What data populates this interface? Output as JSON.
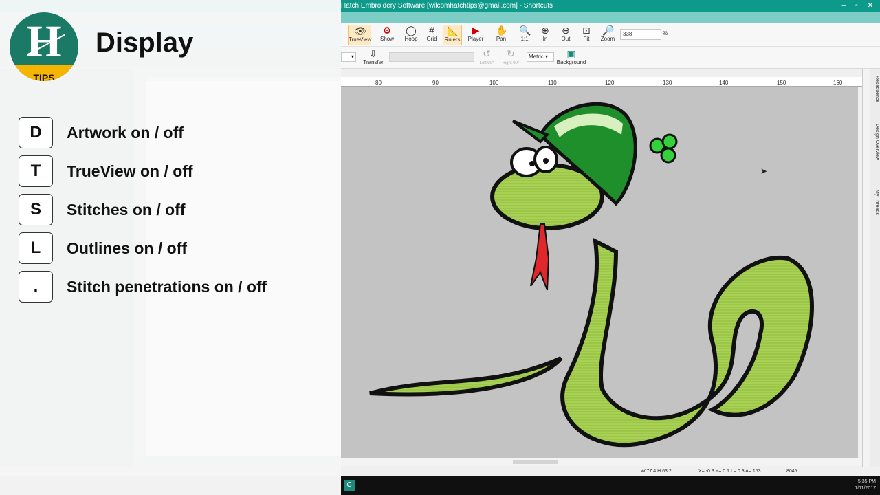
{
  "overlay": {
    "logo_letter": "H",
    "logo_tips": "TIPS",
    "heading": "Display",
    "shortcuts": [
      {
        "key": "D",
        "label": "Artwork on / off"
      },
      {
        "key": "T",
        "label": "TrueView on / off"
      },
      {
        "key": "S",
        "label": "Stitches on / off"
      },
      {
        "key": "L",
        "label": "Outlines on / off"
      },
      {
        "key": ".",
        "label": "Stitch penetrations on / off"
      }
    ]
  },
  "app": {
    "title": "Hatch Embroidery Software [wilcomhatchtips@gmail.com] - Shortcuts",
    "window_buttons": [
      "–",
      "▫",
      "✕"
    ],
    "toolbar1": [
      {
        "label": "TrueView",
        "icon": "trueview-icon"
      },
      {
        "label": "Show",
        "icon": "show-icon"
      },
      {
        "label": "Hoop",
        "icon": "hoop-icon"
      },
      {
        "label": "Grid",
        "icon": "grid-icon"
      },
      {
        "label": "Rulers",
        "icon": "rulers-icon"
      },
      {
        "label": "Player",
        "icon": "player-icon"
      },
      {
        "label": "Pan",
        "icon": "pan-icon"
      },
      {
        "label": "1:1",
        "icon": "zoom-1-1-icon"
      },
      {
        "label": "In",
        "icon": "zoom-in-icon"
      },
      {
        "label": "Out",
        "icon": "zoom-out-icon"
      },
      {
        "label": "Fit",
        "icon": "zoom-fit-icon"
      },
      {
        "label": "Zoom",
        "icon": "zoom-icon"
      }
    ],
    "zoom_value": "338",
    "zoom_unit": "%",
    "toolbar2": {
      "transfer": "Transfer",
      "left": "Left 90°",
      "right": "Right 90°",
      "metric": "Metric",
      "background": "Background"
    },
    "ruler_ticks": [
      "80",
      "90",
      "100",
      "110",
      "120",
      "130",
      "140",
      "150",
      "160"
    ],
    "right_tabs": [
      "Resequence",
      "Design Overview",
      "My Threads"
    ],
    "status": {
      "dims": "W 77.4 H 63.2",
      "coords": "X= -0.3 Y= 0.1 L= 0.3 A= 153",
      "stitches": "8045"
    },
    "clock": {
      "time": "5:35 PM",
      "date": "1/11/2017"
    },
    "colors": {
      "titlebar": "#0e9a8a",
      "canvas": "#c3c3c3",
      "snake": "#9ccc4a",
      "hat_green": "#1f8f2c"
    }
  }
}
